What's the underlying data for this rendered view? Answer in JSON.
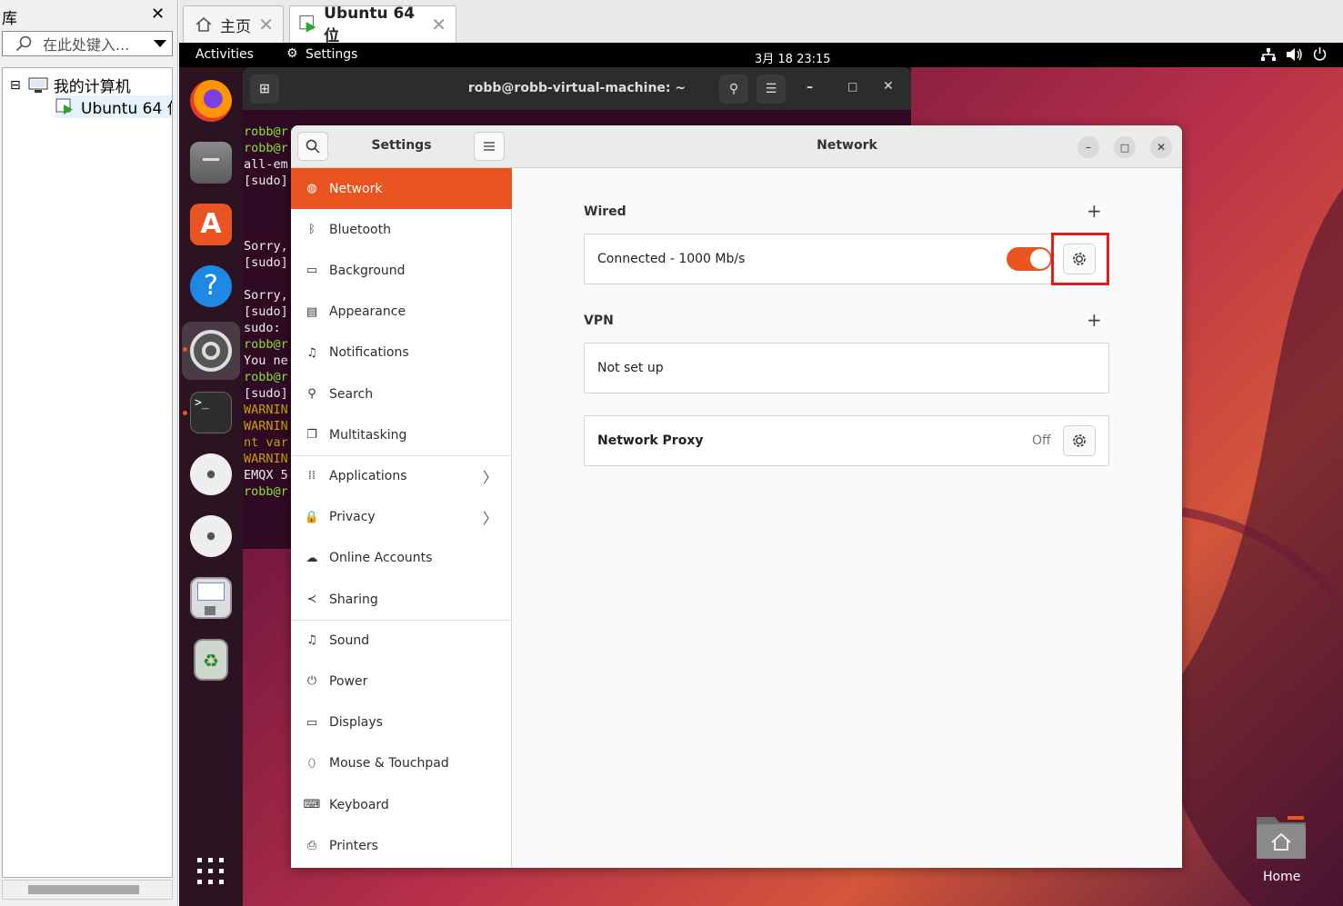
{
  "library": {
    "title": "库",
    "close": "✕",
    "search_placeholder": "在此处键入...",
    "tree": [
      {
        "label": "我的计算机",
        "expander": "⊟"
      },
      {
        "label": "Ubuntu 64 位"
      }
    ]
  },
  "tabs": [
    {
      "label": "主页",
      "close": "✕"
    },
    {
      "label": "Ubuntu 64 位",
      "close": "✕"
    }
  ],
  "topbar": {
    "activities": "Activities",
    "app": "Settings",
    "clock": "3月 18  23:15"
  },
  "terminal": {
    "title": "robb@robb-virtual-machine: ~",
    "lines": [
      {
        "text": "robb@r",
        "color": "#8ae234"
      },
      {
        "text": "robb@r",
        "color": "#8ae234"
      },
      {
        "text": "all-em",
        "color": "#eeeeee"
      },
      {
        "text": "[sudo]",
        "color": "#eeeeee"
      },
      {
        "text": "",
        "color": "#eeeeee"
      },
      {
        "text": "",
        "color": "#eeeeee"
      },
      {
        "text": "",
        "color": "#eeeeee"
      },
      {
        "text": "Sorry,",
        "color": "#eeeeee"
      },
      {
        "text": "[sudo]",
        "color": "#eeeeee"
      },
      {
        "text": "",
        "color": "#eeeeee"
      },
      {
        "text": "Sorry,",
        "color": "#eeeeee"
      },
      {
        "text": "[sudo]",
        "color": "#eeeeee"
      },
      {
        "text": "sudo: ",
        "color": "#eeeeee"
      },
      {
        "text": "robb@r",
        "color": "#8ae234"
      },
      {
        "text": "You ne",
        "color": "#eeeeee"
      },
      {
        "text": "robb@r",
        "color": "#8ae234"
      },
      {
        "text": "[sudo]",
        "color": "#eeeeee"
      },
      {
        "text": "WARNIN",
        "color": "#c4a000"
      },
      {
        "text": "WARNIN",
        "color": "#c4a000"
      },
      {
        "text": "nt var",
        "color": "#c4a000"
      },
      {
        "text": "WARNIN",
        "color": "#c4a000"
      },
      {
        "text": "EMQX 5",
        "color": "#eeeeee"
      },
      {
        "text": "robb@r",
        "color": "#8ae234"
      }
    ]
  },
  "settings": {
    "sidebar_title": "Settings",
    "items": [
      {
        "label": "Network",
        "icon": "globe-icon",
        "glyph": "◍",
        "active": true
      },
      {
        "label": "Bluetooth",
        "icon": "bluetooth-icon",
        "glyph": "ᛒ"
      },
      {
        "label": "Background",
        "icon": "background-icon",
        "glyph": "▭"
      },
      {
        "label": "Appearance",
        "icon": "appearance-icon",
        "glyph": "▤"
      },
      {
        "label": "Notifications",
        "icon": "bell-icon",
        "glyph": "♫"
      },
      {
        "label": "Search",
        "icon": "search-icon",
        "glyph": "⚲"
      },
      {
        "label": "Multitasking",
        "icon": "multitasking-icon",
        "glyph": "❐"
      },
      {
        "label": "Applications",
        "icon": "apps-icon",
        "glyph": "⁞⁞",
        "chevron": "〉"
      },
      {
        "label": "Privacy",
        "icon": "lock-icon",
        "glyph": "🔒",
        "chevron": "〉"
      },
      {
        "label": "Online Accounts",
        "icon": "cloud-icon",
        "glyph": "☁"
      },
      {
        "label": "Sharing",
        "icon": "share-icon",
        "glyph": "≺"
      },
      {
        "label": "Sound",
        "icon": "music-icon",
        "glyph": "♫"
      },
      {
        "label": "Power",
        "icon": "power-icon",
        "glyph": "⏻"
      },
      {
        "label": "Displays",
        "icon": "display-icon",
        "glyph": "▭"
      },
      {
        "label": "Mouse & Touchpad",
        "icon": "mouse-icon",
        "glyph": "⬯"
      },
      {
        "label": "Keyboard",
        "icon": "keyboard-icon",
        "glyph": "⌨"
      },
      {
        "label": "Printers",
        "icon": "printer-icon",
        "glyph": "⎙"
      }
    ],
    "panel_title": "Network",
    "wired": {
      "title": "Wired",
      "status": "Connected - 1000 Mb/s",
      "enabled": true
    },
    "vpn": {
      "title": "VPN",
      "status": "Not set up"
    },
    "proxy": {
      "title": "Network Proxy",
      "state": "Off"
    }
  },
  "desktop": {
    "home_label": "Home"
  },
  "colors": {
    "accent": "#e95420",
    "highlight": "#e51d1d"
  }
}
